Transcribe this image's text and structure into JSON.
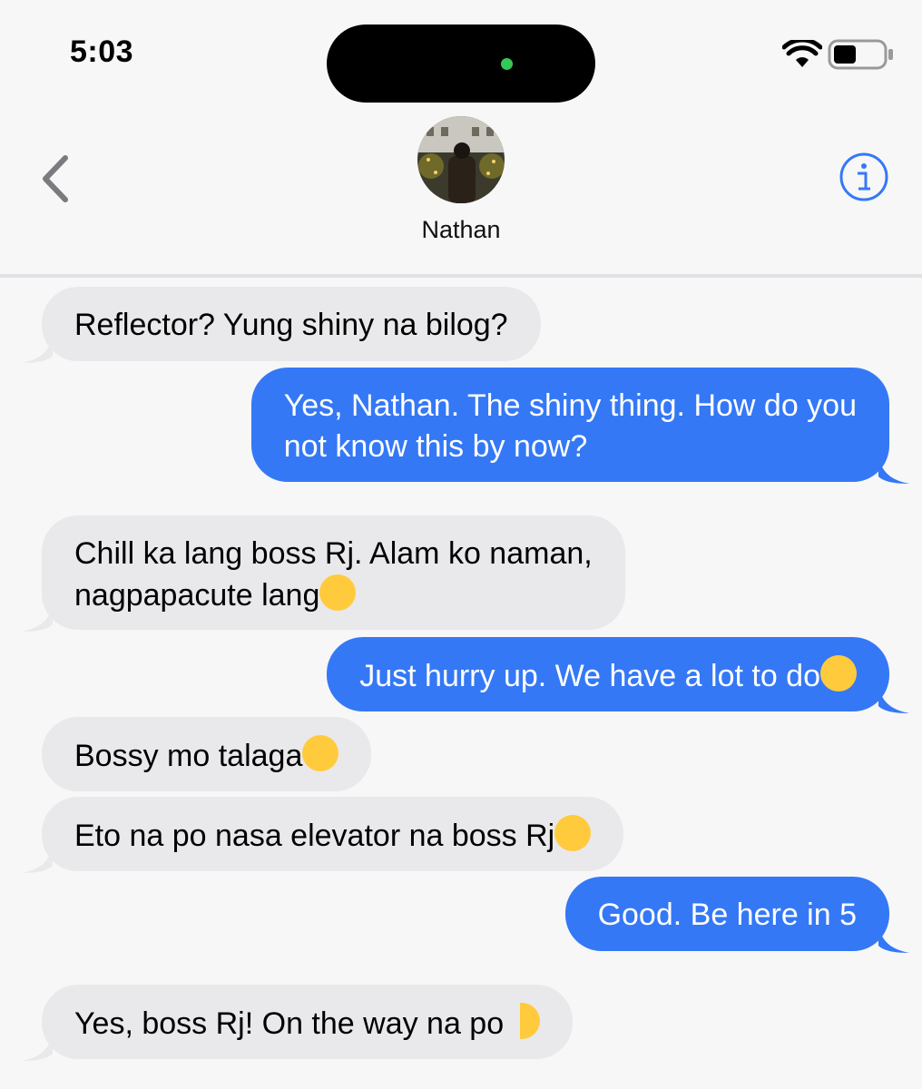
{
  "status_bar": {
    "time": "5:03"
  },
  "header": {
    "contact_name": "Nathan"
  },
  "messages": [
    {
      "side": "in",
      "text": "Reflector? Yung shiny na bilog?"
    },
    {
      "side": "out",
      "line1": "Yes, Nathan. The shiny thing. How do you",
      "line2": "not know this by now?"
    },
    {
      "side": "in",
      "line1": "Chill ka lang boss Rj. Alam ko naman,",
      "line2": "nagpapacute lang",
      "emoji": "tears-of-joy-emoji"
    },
    {
      "side": "out",
      "text": "Just hurry up. We have a lot to do",
      "emoji": "eye-roll-emoji"
    },
    {
      "side": "in",
      "text": "Bossy mo talaga",
      "emoji": "crying-emoji"
    },
    {
      "side": "in",
      "text": "Eto na po nasa elevator na boss Rj",
      "emoji": "pensive-emoji"
    },
    {
      "side": "out",
      "text": "Good. Be here in 5"
    },
    {
      "side": "in",
      "text": "Yes, boss Rj! On the way na po",
      "emoji": "saluting-emoji"
    }
  ],
  "colors": {
    "outgoing": "#3478f6",
    "incoming": "#e9e9eb",
    "accent": "#3478f6",
    "background": "#f7f7f7"
  }
}
